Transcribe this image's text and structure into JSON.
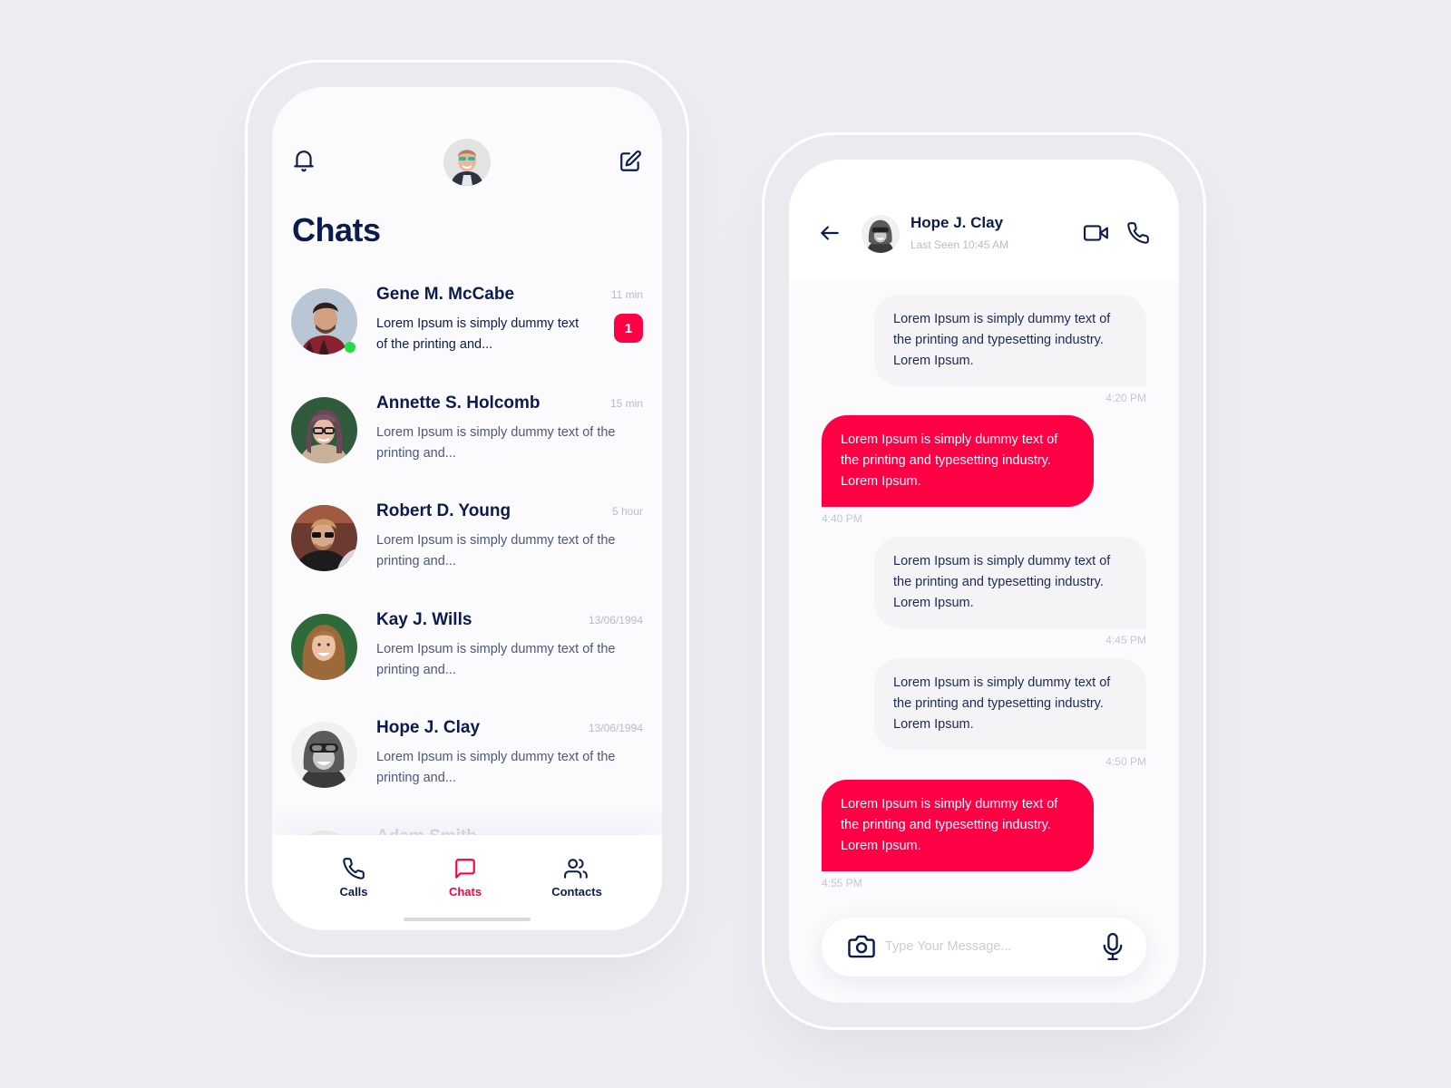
{
  "colors": {
    "accent": "#ff0044",
    "text_primary": "#0c1b4d",
    "text_muted": "#b6bccc",
    "online": "#22dd44",
    "background": "#eeeef2"
  },
  "chats_screen": {
    "header": {
      "left_icon": "bell-icon",
      "center": "profile-avatar",
      "right_icon": "compose-icon"
    },
    "title": "Chats",
    "chats": [
      {
        "name": "Gene M. McCabe",
        "time": "11 min",
        "preview": "Lorem Ipsum is simply dummy text of the printing and...",
        "unread_count": "1",
        "online": true
      },
      {
        "name": "Annette S. Holcomb",
        "time": "15 min",
        "preview": "Lorem Ipsum is simply dummy text of the printing and..."
      },
      {
        "name": "Robert D. Young",
        "time": "5 hour",
        "preview": "Lorem Ipsum is simply dummy text of the printing and..."
      },
      {
        "name": "Kay J. Wills",
        "time": "13/06/1994",
        "preview": "Lorem Ipsum is simply dummy text of the printing and..."
      },
      {
        "name": "Hope J. Clay",
        "time": "13/06/1994",
        "preview": "Lorem Ipsum is simply dummy text of the printing and..."
      },
      {
        "name": "Adam Smith",
        "time": "",
        "preview": ""
      }
    ],
    "tabs": [
      {
        "label": "Calls",
        "icon": "phone-icon",
        "active": false
      },
      {
        "label": "Chats",
        "icon": "chat-bubble-icon",
        "active": true
      },
      {
        "label": "Contacts",
        "icon": "users-icon",
        "active": false
      }
    ]
  },
  "conversation_screen": {
    "contact": {
      "name": "Hope J. Clay",
      "status": "Last Seen 10:45 AM"
    },
    "messages": [
      {
        "direction": "received",
        "text": "Lorem Ipsum is simply dummy text of the printing and typesetting industry. Lorem Ipsum.",
        "time": "4:20 PM"
      },
      {
        "direction": "sent",
        "text": "Lorem Ipsum is simply dummy text of the printing and typesetting industry. Lorem Ipsum.",
        "time": "4:40 PM"
      },
      {
        "direction": "received",
        "text": "Lorem Ipsum is simply dummy text of the printing and typesetting industry. Lorem Ipsum.",
        "time": "4:45 PM"
      },
      {
        "direction": "received",
        "text": "Lorem Ipsum is simply dummy text of the printing and typesetting industry. Lorem Ipsum.",
        "time": "4:50 PM"
      },
      {
        "direction": "sent",
        "text": "Lorem Ipsum is simply dummy text of the printing and typesetting industry. Lorem Ipsum.",
        "time": "4:55 PM"
      }
    ],
    "composer": {
      "placeholder": "Type Your Message...",
      "value": ""
    }
  }
}
